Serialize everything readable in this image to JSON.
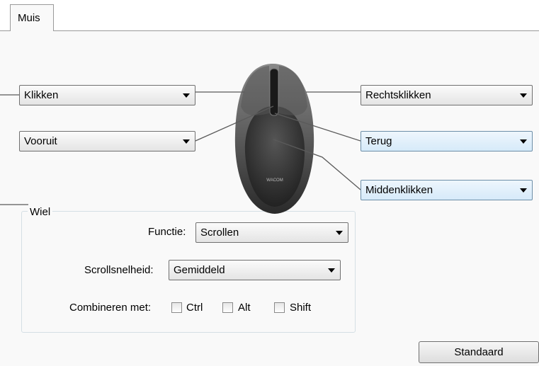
{
  "tab": {
    "label": "Muis"
  },
  "buttons": {
    "left_click": "Klikken",
    "right_click": "Rechtsklikken",
    "forward": "Vooruit",
    "back": "Terug",
    "middle_click": "Middenklikken"
  },
  "mouse": {
    "brand": "WACOM"
  },
  "wheel": {
    "title": "Wiel",
    "function_label": "Functie:",
    "function_value": "Scrollen",
    "speed_label": "Scrollsnelheid:",
    "speed_value": "Gemiddeld",
    "combine_label": "Combineren met:",
    "modifiers": [
      {
        "label": "Ctrl",
        "checked": false
      },
      {
        "label": "Alt",
        "checked": false
      },
      {
        "label": "Shift",
        "checked": false
      }
    ]
  },
  "default_button": "Standaard",
  "colors": {
    "panel_bg": "#f9f9f9",
    "highlight": "#d6eaf9",
    "mouse_body": "#3a3a3a"
  }
}
